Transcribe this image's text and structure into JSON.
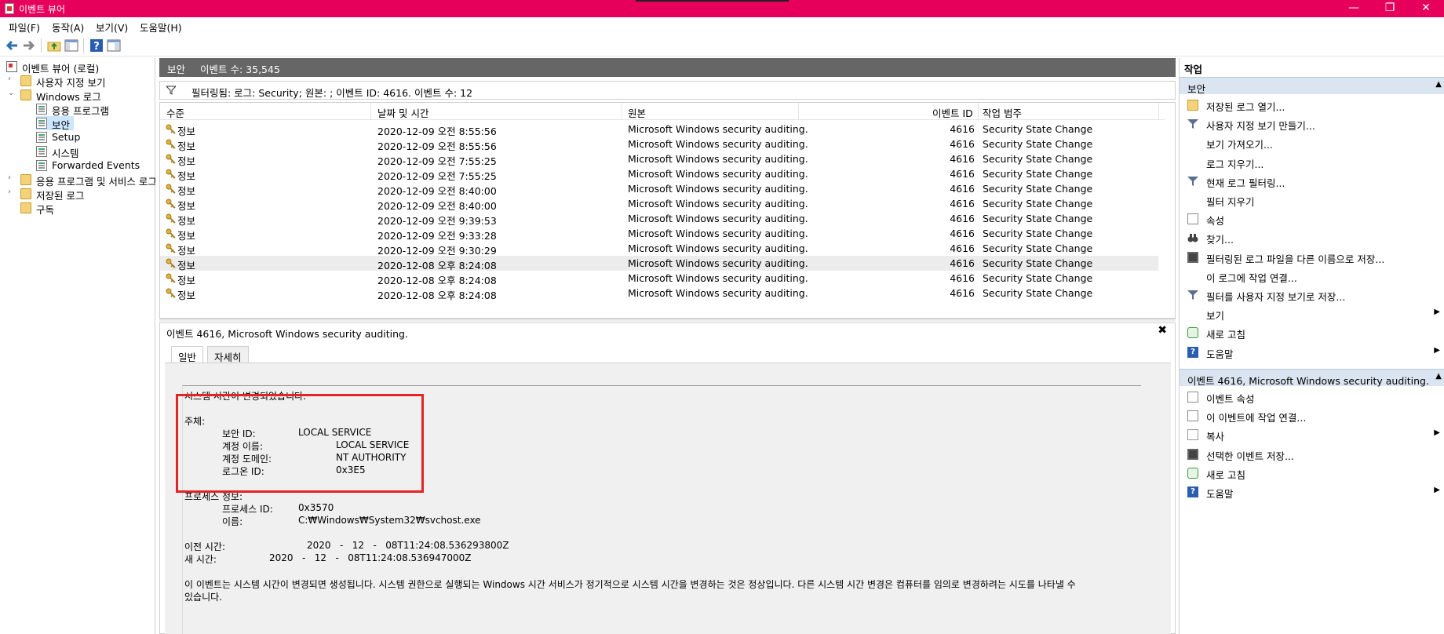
{
  "window": {
    "title": "이벤트 뷰어",
    "minimize": "—",
    "maximize": "❐",
    "close": "✕"
  },
  "menu": [
    "파일(F)",
    "동작(A)",
    "보기(V)",
    "도움말(H)"
  ],
  "tree": {
    "root": "이벤트 뷰어 (로컬)",
    "custom_views": "사용자 지정 보기",
    "windows_logs": "Windows 로그",
    "logs": [
      "응용 프로그램",
      "보안",
      "Setup",
      "시스템",
      "Forwarded Events"
    ],
    "apps_services": "응용 프로그램 및 서비스 로그",
    "saved_logs": "저장된 로그",
    "subscriptions": "구독"
  },
  "center": {
    "log_name": "보안",
    "event_count": "이벤트 수: 35,545",
    "filter_text": "필터링됨: 로그: Security; 원본: ; 이벤트 ID: 4616. 이벤트 수: 12",
    "columns": [
      "수준",
      "날짜 및 시간",
      "원본",
      "이벤트 ID",
      "작업 범주"
    ],
    "rows": [
      {
        "level": "정보",
        "datetime": "2020-12-09 오전 8:55:56",
        "source": "Microsoft Windows security auditing.",
        "id": "4616",
        "category": "Security State Change"
      },
      {
        "level": "정보",
        "datetime": "2020-12-09 오전 8:55:56",
        "source": "Microsoft Windows security auditing.",
        "id": "4616",
        "category": "Security State Change"
      },
      {
        "level": "정보",
        "datetime": "2020-12-09 오전 7:55:25",
        "source": "Microsoft Windows security auditing.",
        "id": "4616",
        "category": "Security State Change"
      },
      {
        "level": "정보",
        "datetime": "2020-12-09 오전 7:55:25",
        "source": "Microsoft Windows security auditing.",
        "id": "4616",
        "category": "Security State Change"
      },
      {
        "level": "정보",
        "datetime": "2020-12-09 오전 8:40:00",
        "source": "Microsoft Windows security auditing.",
        "id": "4616",
        "category": "Security State Change"
      },
      {
        "level": "정보",
        "datetime": "2020-12-09 오전 8:40:00",
        "source": "Microsoft Windows security auditing.",
        "id": "4616",
        "category": "Security State Change"
      },
      {
        "level": "정보",
        "datetime": "2020-12-09 오전 9:39:53",
        "source": "Microsoft Windows security auditing.",
        "id": "4616",
        "category": "Security State Change"
      },
      {
        "level": "정보",
        "datetime": "2020-12-09 오전 9:33:28",
        "source": "Microsoft Windows security auditing.",
        "id": "4616",
        "category": "Security State Change"
      },
      {
        "level": "정보",
        "datetime": "2020-12-09 오전 9:30:29",
        "source": "Microsoft Windows security auditing.",
        "id": "4616",
        "category": "Security State Change"
      },
      {
        "level": "정보",
        "datetime": "2020-12-08 오후 8:24:08",
        "source": "Microsoft Windows security auditing.",
        "id": "4616",
        "category": "Security State Change"
      },
      {
        "level": "정보",
        "datetime": "2020-12-08 오후 8:24:08",
        "source": "Microsoft Windows security auditing.",
        "id": "4616",
        "category": "Security State Change"
      },
      {
        "level": "정보",
        "datetime": "2020-12-08 오후 8:24:08",
        "source": "Microsoft Windows security auditing.",
        "id": "4616",
        "category": "Security State Change"
      }
    ],
    "selected_row": 9
  },
  "detail": {
    "title": "이벤트 4616, Microsoft Windows security auditing.",
    "close": "✖",
    "tabs": [
      "일반",
      "자세히"
    ],
    "message": {
      "line1": "시스템 시간이 변경되었습니다.",
      "subject": "주체:",
      "security_id_label": "보안 ID:",
      "security_id": "LOCAL SERVICE",
      "account_name_label": "계정 이름:",
      "account_name": "LOCAL SERVICE",
      "account_domain_label": "계정 도메인:",
      "account_domain": "NT AUTHORITY",
      "logon_id_label": "로그온 ID:",
      "logon_id": "0x3E5",
      "process_info": "프로세스 정보:",
      "process_id_label": "프로세스 ID:",
      "process_id": "0x3570",
      "name_label": "이름:",
      "name": "C:₩Windows₩System32₩svchost.exe",
      "prev_time_label": "이전 시간:",
      "prev_time": "2020   -   12   -   08T11:24:08.536293800Z",
      "new_time_label": "새 시간:",
      "new_time": "2020   -   12   -   08T11:24:08.536947000Z",
      "desc1": "이 이벤트는 시스템 시간이 변경되면 생성됩니다. 시스템 권한으로 실행되는 Windows 시간 서비스가 정기적으로 시스템 시간을 변경하는 것은 정상입니다. 다른 시스템 시간 변경은 컴퓨터를 임의로 변경하려는 시도를 나타낼 수",
      "desc2": "있습니다."
    }
  },
  "actions": {
    "header": "작업",
    "section1": "보안",
    "items1": [
      {
        "label": "저장된 로그 열기...",
        "icon": "folder-open-icon"
      },
      {
        "label": "사용자 지정 보기 만들기...",
        "icon": "funnel-star-icon"
      },
      {
        "label": "보기 가져오기...",
        "icon": ""
      },
      {
        "label": "로그 지우기...",
        "icon": ""
      },
      {
        "label": "현재 로그 필터링...",
        "icon": "funnel-icon"
      },
      {
        "label": "필터 지우기",
        "icon": ""
      },
      {
        "label": "속성",
        "icon": "properties-icon"
      },
      {
        "label": "찾기...",
        "icon": "binoculars-icon"
      },
      {
        "label": "필터링된 로그 파일을 다른 이름으로 저장...",
        "icon": "save-icon"
      },
      {
        "label": "이 로그에 작업 연결...",
        "icon": ""
      },
      {
        "label": "필터를 사용자 지정 보기로 저장...",
        "icon": "funnel-save-icon"
      },
      {
        "label": "보기",
        "icon": "",
        "submenu": "▶"
      },
      {
        "label": "새로 고침",
        "icon": "refresh-icon"
      },
      {
        "label": "도움말",
        "icon": "help-icon",
        "submenu": "▶"
      }
    ],
    "section2": "이벤트 4616, Microsoft Windows security auditing.",
    "items2": [
      {
        "label": "이벤트 속성",
        "icon": "properties-icon"
      },
      {
        "label": "이 이벤트에 작업 연결...",
        "icon": "task-icon"
      },
      {
        "label": "복사",
        "icon": "copy-icon",
        "submenu": "▶"
      },
      {
        "label": "선택한 이벤트 저장...",
        "icon": "save-icon"
      },
      {
        "label": "새로 고침",
        "icon": "refresh-icon"
      },
      {
        "label": "도움말",
        "icon": "help-icon",
        "submenu": "▶"
      }
    ],
    "collapse": "▲"
  }
}
